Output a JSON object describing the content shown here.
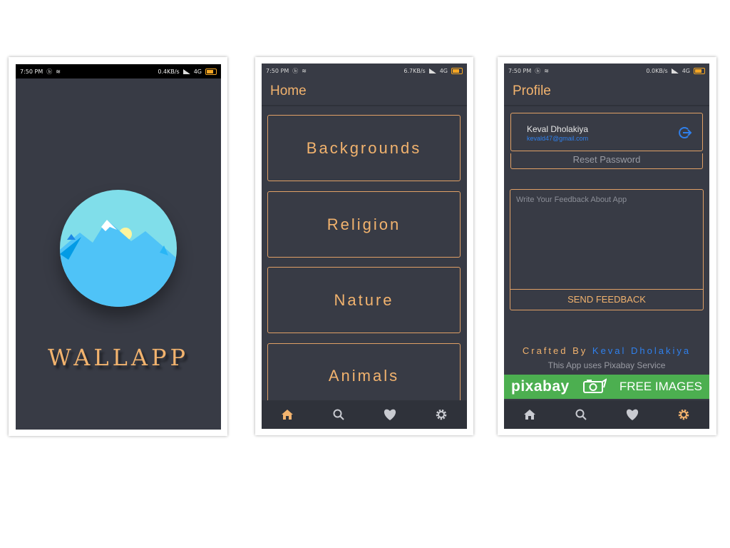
{
  "status_bar": {
    "time": "7:50 PM",
    "splash_speed": "0.4KB/s",
    "home_speed": "6.7KB/s",
    "profile_speed": "0.0KB/s",
    "network": "4G"
  },
  "splash": {
    "app_name": "WALLAPP"
  },
  "home": {
    "title": "Home",
    "categories": [
      "Backgrounds",
      "Religion",
      "Nature",
      "Animals"
    ]
  },
  "profile": {
    "title": "Profile",
    "user_name": "Keval Dholakiya",
    "user_email": "kevald47@gmail.com",
    "reset_label": "Reset Password",
    "feedback_placeholder": "Write Your Feedback About App",
    "send_label": "SEND FEEDBACK",
    "crafted_prefix": "Crafted By",
    "crafted_name": "Keval Dholakiya",
    "pixabay_note": "This App uses Pixabay Service",
    "pixabay_brand": "pixabay",
    "pixabay_cta": "FREE IMAGES"
  },
  "bottom_nav": {
    "items": [
      "home-icon",
      "search-icon",
      "heart-icon",
      "settings-icon"
    ]
  },
  "colors": {
    "accent": "#f2b36e",
    "background": "#383b45",
    "nav_bg": "#2f323a",
    "inactive_icon": "#c9cbd1",
    "link_blue": "#2f80ed",
    "pixabay_green": "#4caf50"
  }
}
